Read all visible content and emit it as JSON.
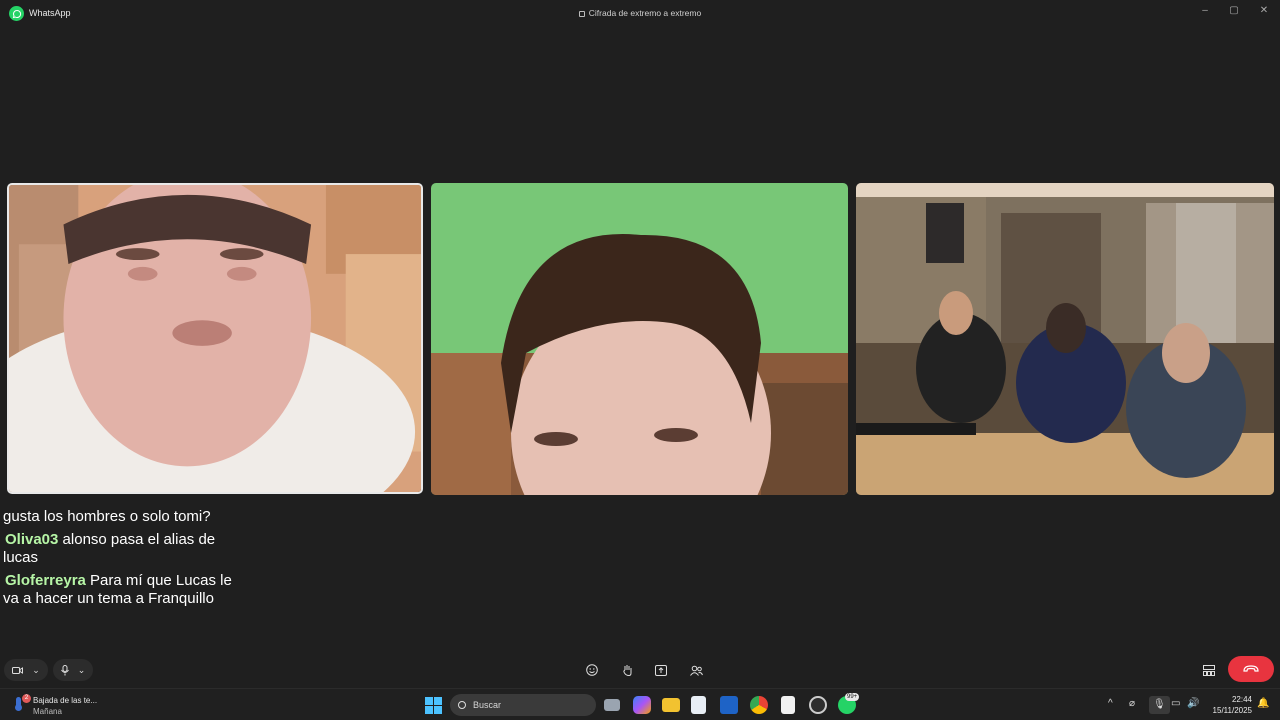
{
  "window": {
    "app_name": "WhatsApp",
    "encryption_label": "Cifrada de extremo a extremo"
  },
  "chat_overlay": {
    "lines": [
      {
        "user": "",
        "text": "gusta los hombres o solo tomi?"
      },
      {
        "user": "Oliva03",
        "text": "alonso pasa el alias de lucas"
      },
      {
        "user": "Gloferreyra",
        "text": "Para mí que Lucas le va a hacer un tema a Franquillo"
      }
    ]
  },
  "video_tiles": [
    {
      "name": "participant-1",
      "active_speaker": true
    },
    {
      "name": "participant-2",
      "active_speaker": false
    },
    {
      "name": "participant-3",
      "active_speaker": false
    }
  ],
  "call_controls": {
    "camera": "camera-icon",
    "microphone": "microphone-icon",
    "emoji": "emoji-icon",
    "raise_hand": "raise-hand-icon",
    "share_screen": "share-screen-icon",
    "participants": "participants-icon",
    "layout": "layout-icon",
    "end_call": "end-call-icon"
  },
  "taskbar": {
    "notification": {
      "badge": "2",
      "title": "Bajada de las te...",
      "subtitle": "Mañana"
    },
    "search_placeholder": "Buscar",
    "whatsapp_badge": "99+",
    "time": "22:44",
    "date": "15/11/2025"
  },
  "colors": {
    "background": "#1f1f1f",
    "accent_green": "#25d366",
    "username_green": "#b6f5a6",
    "end_call_red": "#e8343f"
  }
}
